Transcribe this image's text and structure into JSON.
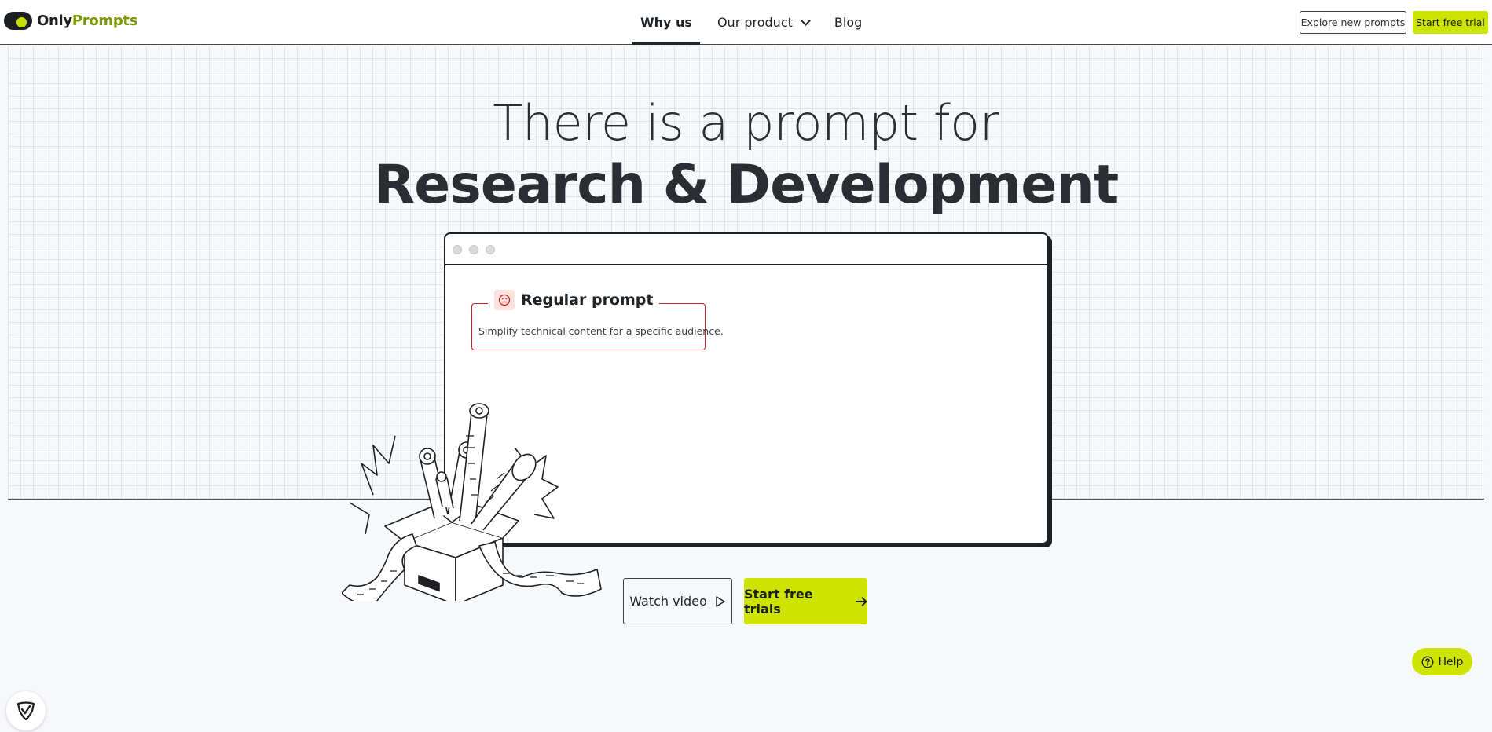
{
  "header": {
    "logo": {
      "part1": "Only",
      "part2": "Prompts"
    },
    "nav": [
      {
        "label": "Why us",
        "active": true
      },
      {
        "label": "Our product",
        "has_dropdown": true
      },
      {
        "label": "Blog"
      }
    ],
    "explore_label": "Explore new prompts",
    "trial_label": "Start free trial"
  },
  "hero": {
    "title_line1": "There is a prompt for",
    "title_line2": "Research & Development"
  },
  "window": {
    "prompt_card": {
      "title": "Regular prompt",
      "text": "Simplify technical content for a specific audience.",
      "icon": "sad-face-icon"
    }
  },
  "actions": {
    "watch_label": "Watch video",
    "trials_label": "Start free trials"
  },
  "help_label": "Help",
  "colors": {
    "accent": "#cce400",
    "brand_green": "#7a9a00",
    "card_border": "#c8232c",
    "dark": "#1d1f22"
  }
}
